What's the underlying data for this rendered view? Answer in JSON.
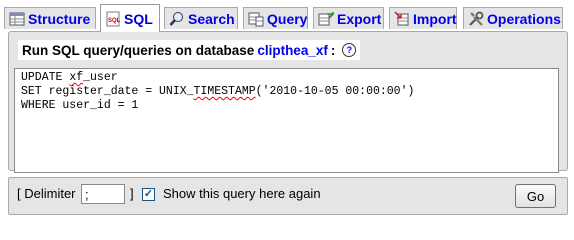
{
  "tabs": [
    {
      "label": "Structure",
      "icon": "structure-icon",
      "active": false
    },
    {
      "label": "SQL",
      "icon": "sql-icon",
      "active": true
    },
    {
      "label": "Search",
      "icon": "search-icon",
      "active": false
    },
    {
      "label": "Query",
      "icon": "query-icon",
      "active": false
    },
    {
      "label": "Export",
      "icon": "export-icon",
      "active": false
    },
    {
      "label": "Import",
      "icon": "import-icon",
      "active": false
    },
    {
      "label": "Operations",
      "icon": "operations-icon",
      "active": false
    }
  ],
  "form": {
    "legend_prefix": "Run SQL query/queries on database",
    "database": "clipthea_xf",
    "legend_suffix": ":",
    "help_icon": "help-icon"
  },
  "query": {
    "lines": [
      "UPDATE xf_user",
      "SET register_date = UNIX_TIMESTAMP('2010-10-05 00:00:00')",
      "WHERE user_id = 1"
    ]
  },
  "bottom": {
    "delimiter_label": "[ Delimiter",
    "delimiter_value": ";",
    "delimiter_close": "]",
    "show_query_checked": true,
    "show_query_label": "Show this query here again",
    "go_label": "Go"
  },
  "colors": {
    "link": "#0000ee",
    "tab_bg": "#e5e5e5",
    "panel_bg": "#e5e5e5"
  }
}
